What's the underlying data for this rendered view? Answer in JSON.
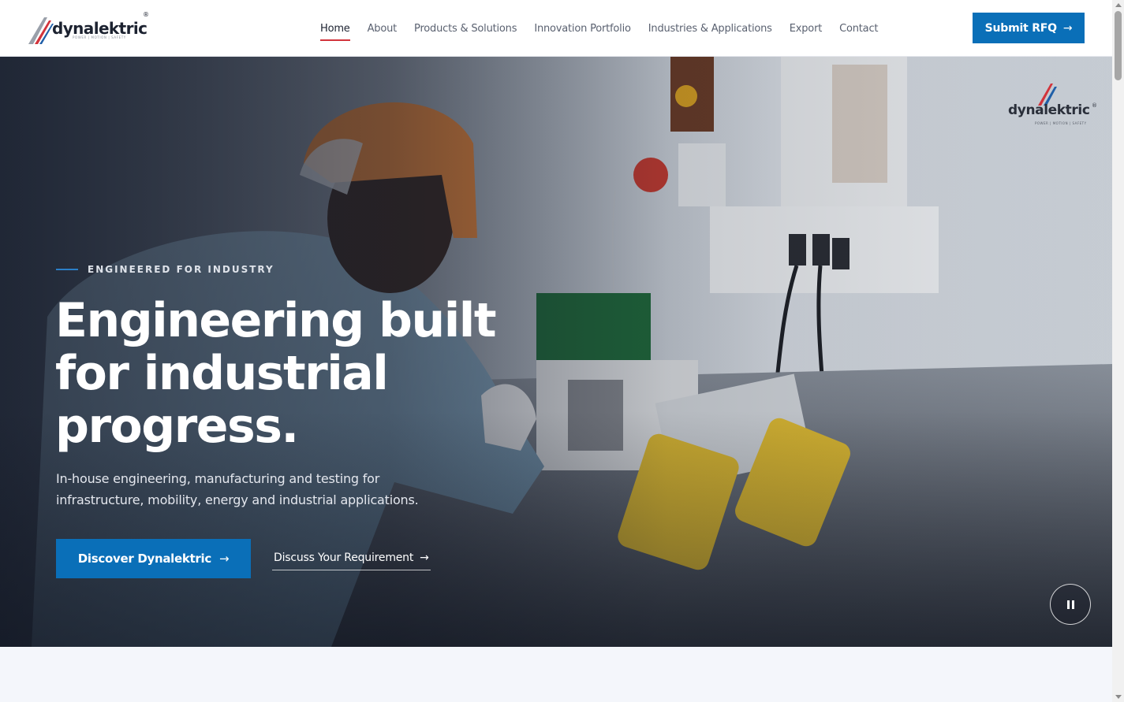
{
  "brand": {
    "name": "dynalektric",
    "registered": "®",
    "tagline": "POWER | MOTION | SAFETY"
  },
  "nav": {
    "items": [
      {
        "label": "Home",
        "active": true
      },
      {
        "label": "About",
        "active": false
      },
      {
        "label": "Products & Solutions",
        "active": false
      },
      {
        "label": "Innovation Portfolio",
        "active": false
      },
      {
        "label": "Industries & Applications",
        "active": false
      },
      {
        "label": "Export",
        "active": false
      },
      {
        "label": "Contact",
        "active": false
      }
    ],
    "cta_label": "Submit RFQ",
    "cta_arrow": "→"
  },
  "hero": {
    "eyebrow": "ENGINEERED FOR INDUSTRY",
    "headline": [
      "Engineering built",
      "for industrial",
      "progress."
    ],
    "subtitle": [
      "In-house engineering, manufacturing and testing for",
      "infrastructure, mobility, energy and industrial applications."
    ],
    "primary_label": "Discover Dynalektric",
    "secondary_label": "Discuss Your Requirement",
    "arrow": "→",
    "video_control": "pause-icon",
    "watermark": "dynalektric"
  },
  "colors": {
    "accent_blue": "#0a6fb8",
    "accent_red": "#d2343c",
    "text_dark": "#1c2230",
    "nav_text": "#5a6170"
  }
}
